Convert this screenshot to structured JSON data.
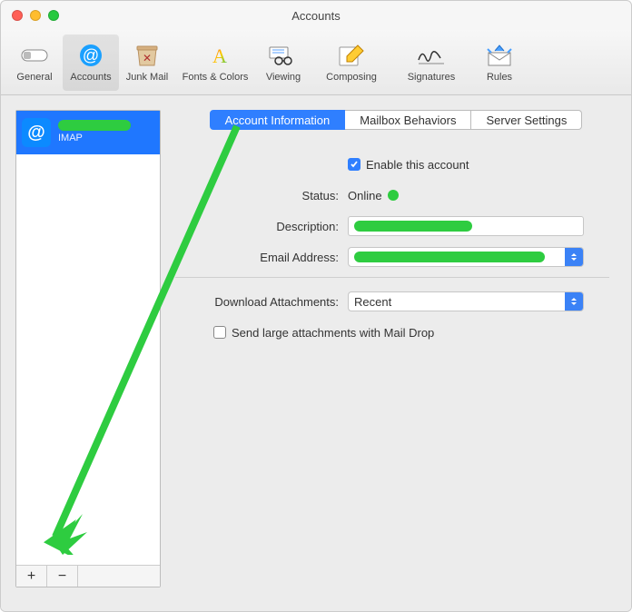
{
  "window": {
    "title": "Accounts"
  },
  "toolbar": {
    "items": [
      {
        "label": "General"
      },
      {
        "label": "Accounts"
      },
      {
        "label": "Junk Mail"
      },
      {
        "label": "Fonts & Colors"
      },
      {
        "label": "Viewing"
      },
      {
        "label": "Composing"
      },
      {
        "label": "Signatures"
      },
      {
        "label": "Rules"
      }
    ],
    "selected": 1
  },
  "sidebar": {
    "accounts": [
      {
        "name_masked": true,
        "type": "IMAP"
      }
    ],
    "add_label": "+",
    "remove_label": "−"
  },
  "tabs": {
    "items": [
      {
        "label": "Account Information"
      },
      {
        "label": "Mailbox Behaviors"
      },
      {
        "label": "Server Settings"
      }
    ],
    "selected": 0
  },
  "form": {
    "enable_label": "Enable this account",
    "enable_checked": true,
    "status_label": "Status:",
    "status_value": "Online",
    "description_label": "Description:",
    "description_masked": true,
    "email_label": "Email Address:",
    "email_masked": true,
    "download_label": "Download Attachments:",
    "download_value": "Recent",
    "maildrop_label": "Send large attachments with Mail Drop",
    "maildrop_checked": false
  },
  "annotation": {
    "arrow_color": "#2ecc40"
  }
}
